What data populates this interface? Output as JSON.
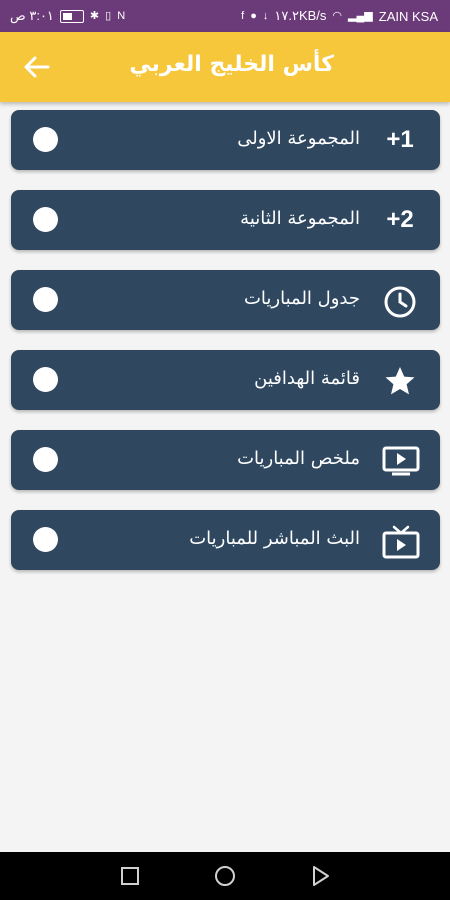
{
  "status_bar": {
    "time": "٣:٠١ ص",
    "speed": "١٧.٢KB/s",
    "carrier": "ZAIN KSA"
  },
  "app_bar": {
    "title": "كأس الخليج العربي"
  },
  "menu": [
    {
      "label": "المجموعة الاولى",
      "lead_text": "+1",
      "icon": "plus-one"
    },
    {
      "label": "المجموعة الثانية",
      "lead_text": "+2",
      "icon": "plus-two"
    },
    {
      "label": "جدول المباريات",
      "lead_text": "",
      "icon": "clock-icon"
    },
    {
      "label": "قائمة الهدافين",
      "lead_text": "",
      "icon": "star-icon"
    },
    {
      "label": "ملخص المباريات",
      "lead_text": "",
      "icon": "video-screen-icon"
    },
    {
      "label": "البث المباشر للمباريات",
      "lead_text": "",
      "icon": "live-tv-icon"
    }
  ],
  "colors": {
    "status_bar": "#6b3a78",
    "app_bar": "#f6c63b",
    "menu_item": "#2f4860",
    "background": "#f4f4f4"
  }
}
